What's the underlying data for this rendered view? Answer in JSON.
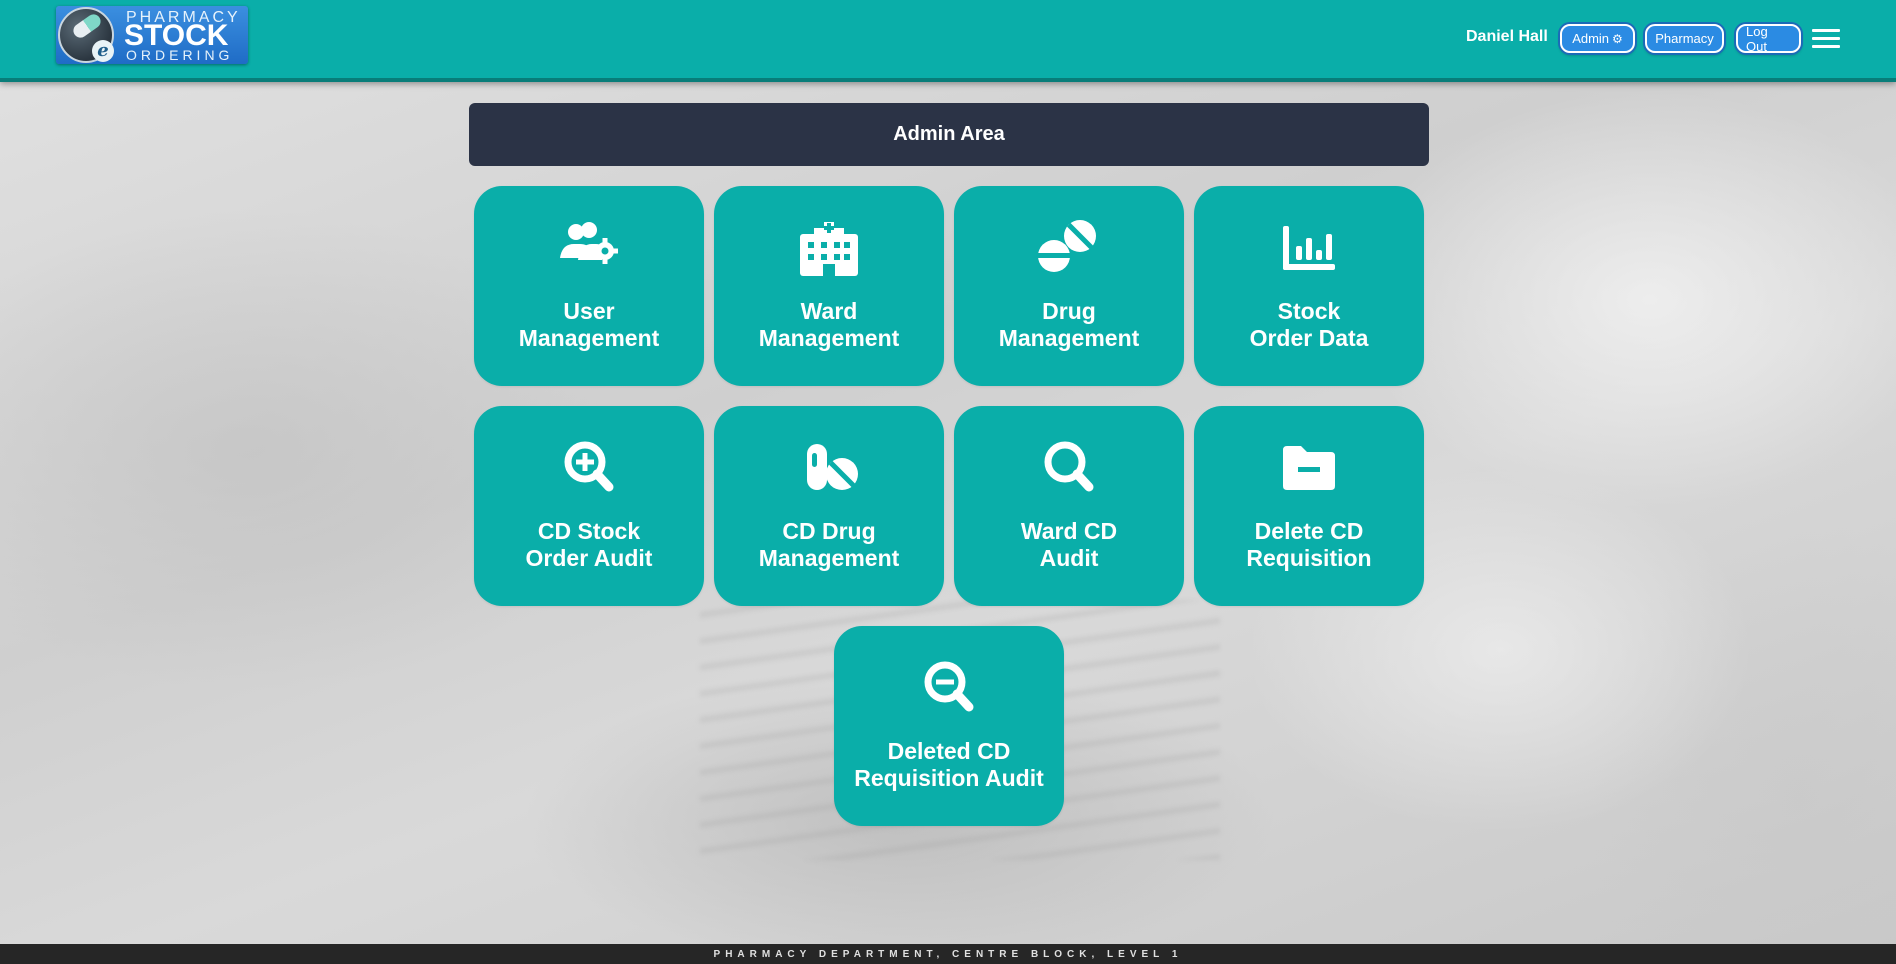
{
  "header": {
    "logo": {
      "line1": "PHARMACY",
      "line2": "STOCK",
      "line3": "ORDERING",
      "badge": "e"
    },
    "user_name": "Daniel Hall",
    "buttons": {
      "admin": "Admin",
      "pharmacy": "Pharmacy",
      "logout": "Log Out"
    },
    "icons": {
      "admin_icon": "gear-icon",
      "menu_icon": "hamburger-menu-icon"
    }
  },
  "page": {
    "title": "Admin Area"
  },
  "tiles": [
    {
      "label": "User\nManagement",
      "icon": "users-cog-icon"
    },
    {
      "label": "Ward\nManagement",
      "icon": "hospital-icon"
    },
    {
      "label": "Drug\nManagement",
      "icon": "tablets-icon"
    },
    {
      "label": "Stock\nOrder Data",
      "icon": "bar-chart-icon"
    },
    {
      "label": "CD Stock\nOrder Audit",
      "icon": "search-plus-icon"
    },
    {
      "label": "CD Drug\nManagement",
      "icon": "pills-icon"
    },
    {
      "label": "Ward CD\nAudit",
      "icon": "search-icon"
    },
    {
      "label": "Delete CD\nRequisition",
      "icon": "folder-minus-icon"
    },
    {
      "label": "Deleted CD\nRequisition Audit",
      "icon": "search-minus-icon"
    }
  ],
  "footer": {
    "text": "PHARMACY DEPARTMENT, CENTRE BLOCK, LEVEL 1"
  },
  "colors": {
    "brand": "#0aaea9",
    "title_bar": "#2b3346",
    "button": "#2b8be3",
    "footer": "#262626"
  }
}
